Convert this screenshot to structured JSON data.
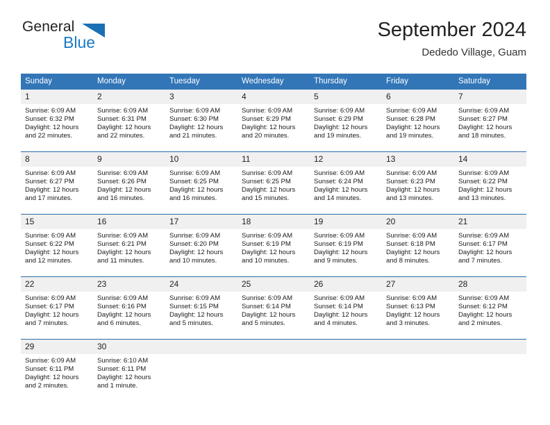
{
  "brand": {
    "name_part1": "General",
    "name_part2": "Blue",
    "triangle_color": "#1a6fb5",
    "blue_color": "#1a7ac4"
  },
  "header": {
    "title": "September 2024",
    "subtitle": "Dededo Village, Guam"
  },
  "theme": {
    "header_bg": "#3276b8",
    "daynum_bg": "#f0f0f0",
    "rule_color": "#2b6cab"
  },
  "calendar": {
    "weekday_headers": [
      "Sunday",
      "Monday",
      "Tuesday",
      "Wednesday",
      "Thursday",
      "Friday",
      "Saturday"
    ],
    "weeks": [
      [
        {
          "day": "1",
          "sunrise": "Sunrise: 6:09 AM",
          "sunset": "Sunset: 6:32 PM",
          "daylight_line1": "Daylight: 12 hours",
          "daylight_line2": "and 22 minutes."
        },
        {
          "day": "2",
          "sunrise": "Sunrise: 6:09 AM",
          "sunset": "Sunset: 6:31 PM",
          "daylight_line1": "Daylight: 12 hours",
          "daylight_line2": "and 22 minutes."
        },
        {
          "day": "3",
          "sunrise": "Sunrise: 6:09 AM",
          "sunset": "Sunset: 6:30 PM",
          "daylight_line1": "Daylight: 12 hours",
          "daylight_line2": "and 21 minutes."
        },
        {
          "day": "4",
          "sunrise": "Sunrise: 6:09 AM",
          "sunset": "Sunset: 6:29 PM",
          "daylight_line1": "Daylight: 12 hours",
          "daylight_line2": "and 20 minutes."
        },
        {
          "day": "5",
          "sunrise": "Sunrise: 6:09 AM",
          "sunset": "Sunset: 6:29 PM",
          "daylight_line1": "Daylight: 12 hours",
          "daylight_line2": "and 19 minutes."
        },
        {
          "day": "6",
          "sunrise": "Sunrise: 6:09 AM",
          "sunset": "Sunset: 6:28 PM",
          "daylight_line1": "Daylight: 12 hours",
          "daylight_line2": "and 19 minutes."
        },
        {
          "day": "7",
          "sunrise": "Sunrise: 6:09 AM",
          "sunset": "Sunset: 6:27 PM",
          "daylight_line1": "Daylight: 12 hours",
          "daylight_line2": "and 18 minutes."
        }
      ],
      [
        {
          "day": "8",
          "sunrise": "Sunrise: 6:09 AM",
          "sunset": "Sunset: 6:27 PM",
          "daylight_line1": "Daylight: 12 hours",
          "daylight_line2": "and 17 minutes."
        },
        {
          "day": "9",
          "sunrise": "Sunrise: 6:09 AM",
          "sunset": "Sunset: 6:26 PM",
          "daylight_line1": "Daylight: 12 hours",
          "daylight_line2": "and 16 minutes."
        },
        {
          "day": "10",
          "sunrise": "Sunrise: 6:09 AM",
          "sunset": "Sunset: 6:25 PM",
          "daylight_line1": "Daylight: 12 hours",
          "daylight_line2": "and 16 minutes."
        },
        {
          "day": "11",
          "sunrise": "Sunrise: 6:09 AM",
          "sunset": "Sunset: 6:25 PM",
          "daylight_line1": "Daylight: 12 hours",
          "daylight_line2": "and 15 minutes."
        },
        {
          "day": "12",
          "sunrise": "Sunrise: 6:09 AM",
          "sunset": "Sunset: 6:24 PM",
          "daylight_line1": "Daylight: 12 hours",
          "daylight_line2": "and 14 minutes."
        },
        {
          "day": "13",
          "sunrise": "Sunrise: 6:09 AM",
          "sunset": "Sunset: 6:23 PM",
          "daylight_line1": "Daylight: 12 hours",
          "daylight_line2": "and 13 minutes."
        },
        {
          "day": "14",
          "sunrise": "Sunrise: 6:09 AM",
          "sunset": "Sunset: 6:22 PM",
          "daylight_line1": "Daylight: 12 hours",
          "daylight_line2": "and 13 minutes."
        }
      ],
      [
        {
          "day": "15",
          "sunrise": "Sunrise: 6:09 AM",
          "sunset": "Sunset: 6:22 PM",
          "daylight_line1": "Daylight: 12 hours",
          "daylight_line2": "and 12 minutes."
        },
        {
          "day": "16",
          "sunrise": "Sunrise: 6:09 AM",
          "sunset": "Sunset: 6:21 PM",
          "daylight_line1": "Daylight: 12 hours",
          "daylight_line2": "and 11 minutes."
        },
        {
          "day": "17",
          "sunrise": "Sunrise: 6:09 AM",
          "sunset": "Sunset: 6:20 PM",
          "daylight_line1": "Daylight: 12 hours",
          "daylight_line2": "and 10 minutes."
        },
        {
          "day": "18",
          "sunrise": "Sunrise: 6:09 AM",
          "sunset": "Sunset: 6:19 PM",
          "daylight_line1": "Daylight: 12 hours",
          "daylight_line2": "and 10 minutes."
        },
        {
          "day": "19",
          "sunrise": "Sunrise: 6:09 AM",
          "sunset": "Sunset: 6:19 PM",
          "daylight_line1": "Daylight: 12 hours",
          "daylight_line2": "and 9 minutes."
        },
        {
          "day": "20",
          "sunrise": "Sunrise: 6:09 AM",
          "sunset": "Sunset: 6:18 PM",
          "daylight_line1": "Daylight: 12 hours",
          "daylight_line2": "and 8 minutes."
        },
        {
          "day": "21",
          "sunrise": "Sunrise: 6:09 AM",
          "sunset": "Sunset: 6:17 PM",
          "daylight_line1": "Daylight: 12 hours",
          "daylight_line2": "and 7 minutes."
        }
      ],
      [
        {
          "day": "22",
          "sunrise": "Sunrise: 6:09 AM",
          "sunset": "Sunset: 6:17 PM",
          "daylight_line1": "Daylight: 12 hours",
          "daylight_line2": "and 7 minutes."
        },
        {
          "day": "23",
          "sunrise": "Sunrise: 6:09 AM",
          "sunset": "Sunset: 6:16 PM",
          "daylight_line1": "Daylight: 12 hours",
          "daylight_line2": "and 6 minutes."
        },
        {
          "day": "24",
          "sunrise": "Sunrise: 6:09 AM",
          "sunset": "Sunset: 6:15 PM",
          "daylight_line1": "Daylight: 12 hours",
          "daylight_line2": "and 5 minutes."
        },
        {
          "day": "25",
          "sunrise": "Sunrise: 6:09 AM",
          "sunset": "Sunset: 6:14 PM",
          "daylight_line1": "Daylight: 12 hours",
          "daylight_line2": "and 5 minutes."
        },
        {
          "day": "26",
          "sunrise": "Sunrise: 6:09 AM",
          "sunset": "Sunset: 6:14 PM",
          "daylight_line1": "Daylight: 12 hours",
          "daylight_line2": "and 4 minutes."
        },
        {
          "day": "27",
          "sunrise": "Sunrise: 6:09 AM",
          "sunset": "Sunset: 6:13 PM",
          "daylight_line1": "Daylight: 12 hours",
          "daylight_line2": "and 3 minutes."
        },
        {
          "day": "28",
          "sunrise": "Sunrise: 6:09 AM",
          "sunset": "Sunset: 6:12 PM",
          "daylight_line1": "Daylight: 12 hours",
          "daylight_line2": "and 2 minutes."
        }
      ],
      [
        {
          "day": "29",
          "sunrise": "Sunrise: 6:09 AM",
          "sunset": "Sunset: 6:11 PM",
          "daylight_line1": "Daylight: 12 hours",
          "daylight_line2": "and 2 minutes."
        },
        {
          "day": "30",
          "sunrise": "Sunrise: 6:10 AM",
          "sunset": "Sunset: 6:11 PM",
          "daylight_line1": "Daylight: 12 hours",
          "daylight_line2": "and 1 minute."
        },
        {
          "day": "",
          "sunrise": "",
          "sunset": "",
          "daylight_line1": "",
          "daylight_line2": ""
        },
        {
          "day": "",
          "sunrise": "",
          "sunset": "",
          "daylight_line1": "",
          "daylight_line2": ""
        },
        {
          "day": "",
          "sunrise": "",
          "sunset": "",
          "daylight_line1": "",
          "daylight_line2": ""
        },
        {
          "day": "",
          "sunrise": "",
          "sunset": "",
          "daylight_line1": "",
          "daylight_line2": ""
        },
        {
          "day": "",
          "sunrise": "",
          "sunset": "",
          "daylight_line1": "",
          "daylight_line2": ""
        }
      ]
    ]
  }
}
